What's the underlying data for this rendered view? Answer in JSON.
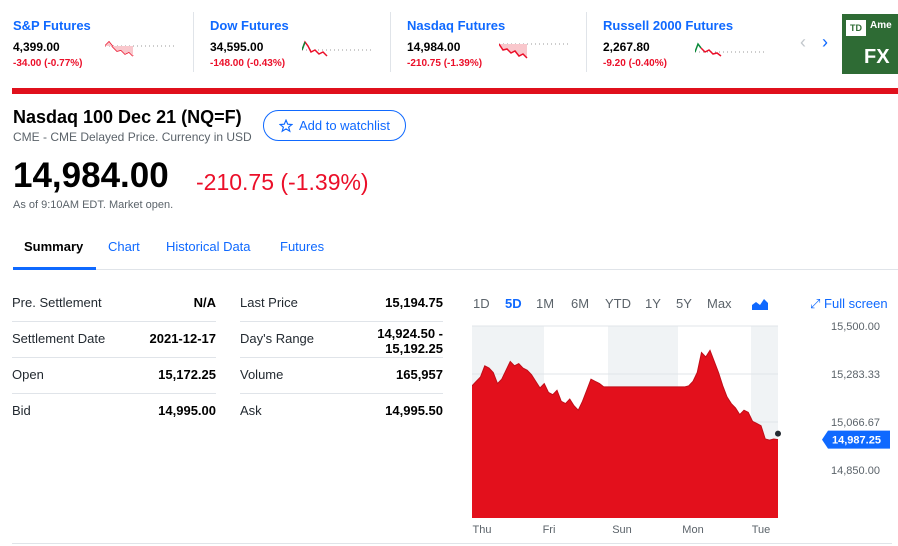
{
  "tickers": [
    {
      "name": "S&P Futures",
      "price": "4,399.00",
      "change": "-34.00 (-0.77%)"
    },
    {
      "name": "Dow Futures",
      "price": "34,595.00",
      "change": "-148.00 (-0.43%)"
    },
    {
      "name": "Nasdaq Futures",
      "price": "14,984.00",
      "change": "-210.75 (-1.39%)"
    },
    {
      "name": "Russell 2000 Futures",
      "price": "2,267.80",
      "change": "-9.20 (-0.40%)"
    }
  ],
  "ad": {
    "logo": "TD",
    "brand_fragment": "Ame",
    "text": "FX"
  },
  "colors": {
    "accent": "#0f69ff",
    "negative": "#eb0f29",
    "brand_bar": "#e0101c",
    "chart_fill": "#e3101c"
  },
  "quote": {
    "title": "Nasdaq 100 Dec 21 (NQ=F)",
    "subtitle": "CME - CME Delayed Price. Currency in USD",
    "watchlist_label": "Add to watchlist",
    "price": "14,984.00",
    "change": "-210.75 (-1.39%)",
    "as_of": "As of 9:10AM EDT. Market open."
  },
  "tabs": [
    "Summary",
    "Chart",
    "Historical Data",
    "Futures"
  ],
  "stats_left": [
    {
      "label": "Pre. Settlement",
      "value": "N/A"
    },
    {
      "label": "Settlement Date",
      "value": "2021-12-17"
    },
    {
      "label": "Open",
      "value": "15,172.25"
    },
    {
      "label": "Bid",
      "value": "14,995.00"
    }
  ],
  "stats_right": [
    {
      "label": "Last Price",
      "value": "15,194.75"
    },
    {
      "label": "Day's Range",
      "value_line1": "14,924.50 -",
      "value_line2": "15,192.25"
    },
    {
      "label": "Volume",
      "value": "165,957"
    },
    {
      "label": "Ask",
      "value": "14,995.50"
    }
  ],
  "chart_controls": {
    "ranges": [
      "1D",
      "5D",
      "1M",
      "6M",
      "YTD",
      "1Y",
      "5Y",
      "Max"
    ],
    "active_range": "5D",
    "fullscreen_label": "Full screen"
  },
  "chart_data": {
    "type": "area",
    "x_labels": [
      "Thu",
      "Fri",
      "Sun",
      "Mon",
      "Tue"
    ],
    "y_ticks": [
      15500.0,
      15283.33,
      15066.67,
      14850.0
    ],
    "y_tick_labels": [
      "15,500.00",
      "15,283.33",
      "15,066.67",
      "14,850.00"
    ],
    "current_label": "14,987.25",
    "ylim": [
      14633.33,
      15500.0
    ],
    "series": [
      {
        "values": [
          15230,
          15250,
          15270,
          15320,
          15310,
          15290,
          15240,
          15260,
          15300,
          15340,
          15320,
          15330,
          15310,
          15300,
          15280,
          15250,
          15220,
          15240,
          15200,
          15190,
          15210,
          15160,
          15150,
          15170,
          15140,
          15120,
          15160,
          15210,
          15260,
          15250,
          15240,
          15225,
          15225,
          15225,
          15225,
          15225,
          15225,
          15225,
          15225,
          15225,
          15225,
          15225,
          15225,
          15225,
          15225,
          15225,
          15225,
          15225,
          15225,
          15225,
          15225,
          15230,
          15250,
          15290,
          15380,
          15360,
          15390,
          15340,
          15290,
          15230,
          15180,
          15150,
          15130,
          15100,
          15120,
          15110,
          15070,
          15060,
          15050,
          14990,
          14985,
          14990,
          14987
        ]
      }
    ]
  }
}
